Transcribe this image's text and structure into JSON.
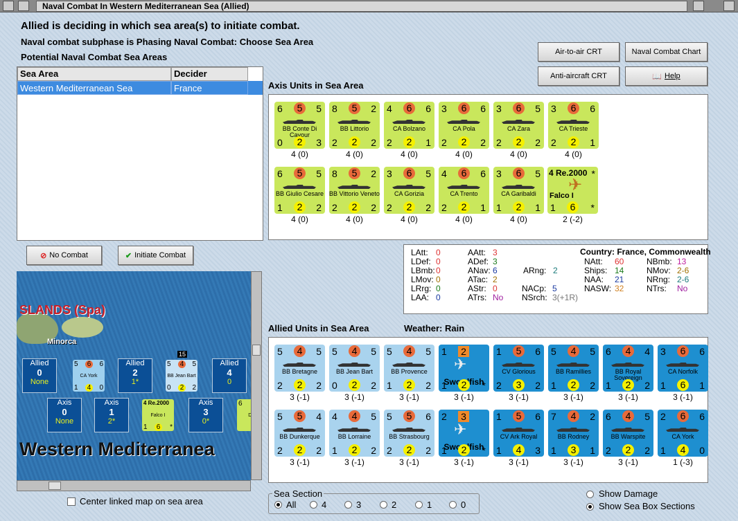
{
  "window": {
    "title": "Naval Combat In Western Mediterranean Sea (Allied)"
  },
  "header": {
    "line1": "Allied is deciding in which sea area(s) to initiate combat.",
    "line2": "Naval combat subphase is Phasing Naval Combat: Choose Sea Area",
    "line3": "Potential Naval Combat Sea Areas"
  },
  "buttons": {
    "air_to_air": "Air-to-air CRT",
    "naval_chart": "Naval Combat Chart",
    "anti_aircraft": "Anti-aircraft CRT",
    "help": "Help",
    "no_combat": "No Combat",
    "initiate": "Initiate Combat"
  },
  "table": {
    "col1": "Sea Area",
    "col2": "Decider",
    "row_area": "Western Mediterranean Sea",
    "row_decider": "France"
  },
  "axis": {
    "label": "Axis Units in Sea Area",
    "units": [
      {
        "tl": "6",
        "tc": "5",
        "tr": "5",
        "name": "BB Conte Di Cavour",
        "bl": "0",
        "bc": "2",
        "br": "3",
        "under": "4 (0)"
      },
      {
        "tl": "8",
        "tc": "5",
        "tr": "2",
        "name": "BB Littorio",
        "bl": "2",
        "bc": "2",
        "br": "2",
        "under": "4 (0)"
      },
      {
        "tl": "4",
        "tc": "6",
        "tr": "6",
        "name": "CA Bolzano",
        "bl": "2",
        "bc": "2",
        "br": "1",
        "under": "4 (0)"
      },
      {
        "tl": "3",
        "tc": "6",
        "tr": "6",
        "name": "CA Pola",
        "bl": "2",
        "bc": "2",
        "br": "2",
        "under": "4 (0)"
      },
      {
        "tl": "3",
        "tc": "6",
        "tr": "5",
        "name": "CA Zara",
        "bl": "2",
        "bc": "2",
        "br": "2",
        "under": "4 (0)"
      },
      {
        "tl": "3",
        "tc": "6",
        "tr": "6",
        "name": "CA Trieste",
        "bl": "2",
        "bc": "2",
        "br": "1",
        "under": "4 (0)"
      },
      {
        "tl": "6",
        "tc": "5",
        "tr": "5",
        "name": "BB Giulio Cesare",
        "bl": "1",
        "bc": "2",
        "br": "2",
        "under": "4 (0)"
      },
      {
        "tl": "8",
        "tc": "5",
        "tr": "2",
        "name": "BB Vittorio Veneto",
        "bl": "2",
        "bc": "2",
        "br": "2",
        "under": "4 (0)"
      },
      {
        "tl": "3",
        "tc": "6",
        "tr": "5",
        "name": "CA Gorizia",
        "bl": "2",
        "bc": "2",
        "br": "2",
        "under": "4 (0)"
      },
      {
        "tl": "4",
        "tc": "6",
        "tr": "6",
        "name": "CA Trento",
        "bl": "2",
        "bc": "2",
        "br": "1",
        "under": "4 (0)"
      },
      {
        "tl": "3",
        "tc": "6",
        "tr": "5",
        "name": "CA Garibaldi",
        "bl": "1",
        "bc": "2",
        "br": "1",
        "under": "4 (0)"
      }
    ],
    "aircraft": {
      "top": "4 Re.2000",
      "star": "*",
      "name": "Falco I",
      "bl": "1",
      "bc": "6",
      "br": "*",
      "under": "2 (-2)"
    }
  },
  "stats": {
    "col1": [
      [
        "LAtt:",
        "0"
      ],
      [
        "LDef:",
        "0"
      ],
      [
        "LBmb:",
        "0"
      ],
      [
        "LMov:",
        "0"
      ],
      [
        "LRrg:",
        "0"
      ],
      [
        "LAA:",
        "0"
      ]
    ],
    "col2": [
      [
        "AAtt:",
        "3"
      ],
      [
        "ADef:",
        "3"
      ],
      [
        "ANav:",
        "6"
      ],
      [
        "ATac:",
        "2"
      ],
      [
        "AStr:",
        "0"
      ],
      [
        "ATrs:",
        "No"
      ]
    ],
    "country": "Country: France, Commonwealth",
    "col3": [
      [
        "ARng:",
        "2"
      ],
      [
        "NACp:",
        "5"
      ],
      [
        "NSrch:",
        "3(+1R)"
      ]
    ],
    "col4": [
      [
        "NAtt:",
        "60"
      ],
      [
        "Ships:",
        "14"
      ],
      [
        "NAA:",
        "21"
      ],
      [
        "NASW:",
        "32"
      ]
    ],
    "col5": [
      [
        "NBmb:",
        "13"
      ],
      [
        "NMov:",
        "2-6"
      ],
      [
        "NRng:",
        "2-6"
      ],
      [
        "NTrs:",
        "No"
      ]
    ]
  },
  "allied": {
    "label": "Allied Units in Sea Area",
    "weather": "Weather:  Rain",
    "units": [
      {
        "tl": "5",
        "tc": "4",
        "tr": "5",
        "name": "BB Bretagne",
        "bl": "2",
        "bc": "2",
        "br": "2",
        "under": "3 (-1)",
        "k": "al"
      },
      {
        "tl": "5",
        "tc": "4",
        "tr": "5",
        "name": "BB Jean Bart",
        "bl": "0",
        "bc": "2",
        "br": "2",
        "under": "3 (-1)",
        "k": "al"
      },
      {
        "tl": "5",
        "tc": "4",
        "tr": "5",
        "name": "BB Provence",
        "bl": "1",
        "bc": "2",
        "br": "2",
        "under": "3 (-1)",
        "k": "al"
      },
      {
        "tl": "1",
        "tc": "2",
        "tr": "",
        "name": "Swordfish",
        "bl": "1",
        "bc": "2",
        "br": "*",
        "under": "3 (-1)",
        "k": "air"
      },
      {
        "tl": "1",
        "tc": "5",
        "tr": "6",
        "name": "CV Glorious",
        "bl": "2",
        "bc": "3",
        "br": "2",
        "under": "3 (-1)",
        "k": "ca"
      },
      {
        "tl": "5",
        "tc": "4",
        "tr": "5",
        "name": "BB Ramillies",
        "bl": "1",
        "bc": "2",
        "br": "2",
        "under": "3 (-1)",
        "k": "ca"
      },
      {
        "tl": "6",
        "tc": "4",
        "tr": "4",
        "name": "BB Royal Sovereign",
        "bl": "1",
        "bc": "2",
        "br": "2",
        "under": "3 (-1)",
        "k": "ca"
      },
      {
        "tl": "3",
        "tc": "6",
        "tr": "6",
        "name": "CA Norfolk",
        "bl": "1",
        "bc": "6",
        "br": "1",
        "under": "3 (-1)",
        "k": "ca"
      },
      {
        "tl": "5",
        "tc": "5",
        "tr": "4",
        "name": "BB Dunkerque",
        "bl": "2",
        "bc": "2",
        "br": "2",
        "under": "3 (-1)",
        "k": "al"
      },
      {
        "tl": "4",
        "tc": "4",
        "tr": "5",
        "name": "BB Lorraine",
        "bl": "1",
        "bc": "2",
        "br": "2",
        "under": "3 (-1)",
        "k": "al"
      },
      {
        "tl": "5",
        "tc": "5",
        "tr": "6",
        "name": "BB Strasbourg",
        "bl": "2",
        "bc": "2",
        "br": "2",
        "under": "3 (-1)",
        "k": "al"
      },
      {
        "tl": "2",
        "tc": "3",
        "tr": "",
        "name": "Swordfish",
        "bl": "1",
        "bc": "2",
        "br": "*",
        "under": "3 (-1)",
        "k": "air"
      },
      {
        "tl": "1",
        "tc": "5",
        "tr": "6",
        "name": "CV Ark Royal",
        "bl": "1",
        "bc": "4",
        "br": "3",
        "under": "3 (-1)",
        "k": "ca"
      },
      {
        "tl": "7",
        "tc": "4",
        "tr": "2",
        "name": "BB Rodney",
        "bl": "1",
        "bc": "3",
        "br": "1",
        "under": "3 (-1)",
        "k": "ca"
      },
      {
        "tl": "6",
        "tc": "4",
        "tr": "5",
        "name": "BB Warspite",
        "bl": "2",
        "bc": "2",
        "br": "2",
        "under": "3 (-1)",
        "k": "ca"
      },
      {
        "tl": "2",
        "tc": "6",
        "tr": "6",
        "name": "CA York",
        "bl": "1",
        "bc": "4",
        "br": "0",
        "under": "1 (-3)",
        "k": "ca"
      }
    ]
  },
  "map": {
    "island": "SLANDS (Spa)",
    "minorca": "Minorca",
    "sea": "Western Mediterranea",
    "allied_boxes": [
      {
        "t": "Allied",
        "n": "0",
        "s": "None"
      },
      {
        "t": "Allied",
        "n": "2",
        "s": "1*"
      },
      {
        "t": "Allied",
        "n": "4",
        "s": "0"
      }
    ],
    "axis_boxes": [
      {
        "t": "Axis",
        "n": "0",
        "s": "None"
      },
      {
        "t": "Axis",
        "n": "1",
        "s": "2*"
      },
      {
        "t": "Axis",
        "n": "3",
        "s": "0*"
      }
    ],
    "mini_ca": {
      "tl": "5",
      "tc": "6",
      "tr": "6",
      "name": "CA York",
      "bl": "1",
      "bc": "4",
      "br": "0"
    },
    "mini_bb": {
      "badge": "15",
      "tl": "5",
      "tc": "4",
      "tr": "5",
      "name": "BB Jean Bart",
      "bl": "0",
      "bc": "2",
      "br": "2"
    },
    "mini_air": {
      "top": "4 Re.2000",
      "name": "Falco I",
      "bl": "1",
      "bc": "6",
      "br": "*"
    },
    "mini_partial": {
      "tl": "6",
      "name": "Di C"
    }
  },
  "footer": {
    "center_map": "Center linked map on sea area",
    "sea_section": "Sea Section",
    "options": [
      "All",
      "4",
      "3",
      "2",
      "1",
      "0"
    ],
    "show_damage": "Show Damage",
    "show_boxes": "Show Sea Box Sections"
  }
}
